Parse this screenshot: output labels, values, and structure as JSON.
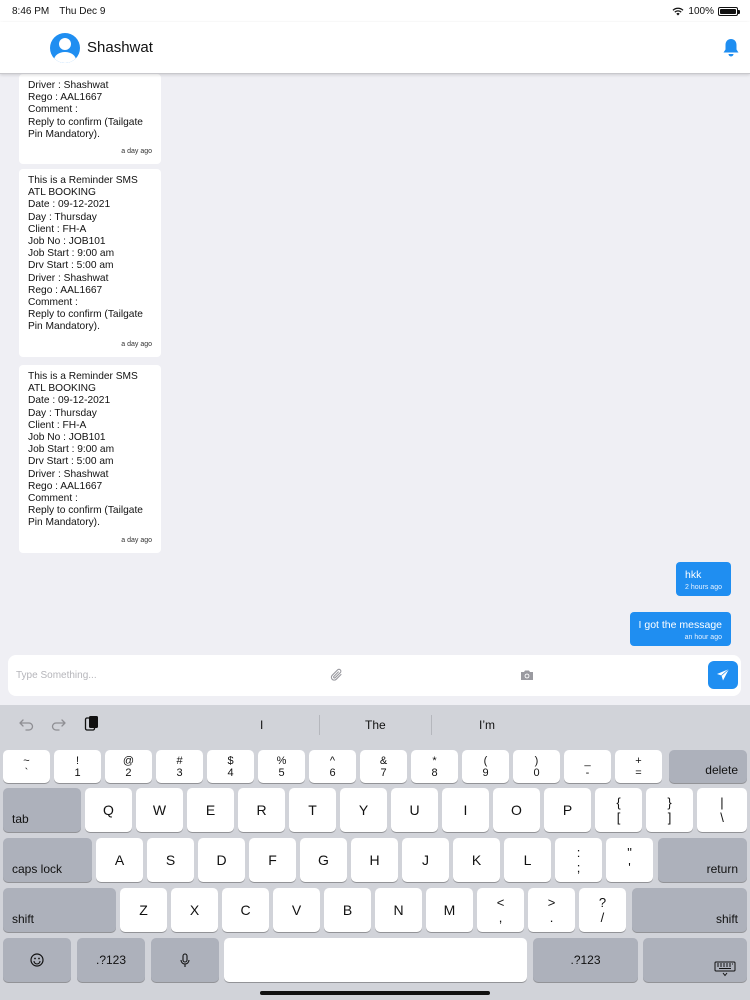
{
  "status": {
    "time": "8:46 PM",
    "date": "Thu Dec 9",
    "battery": "100%"
  },
  "header": {
    "contact_name": "Shashwat"
  },
  "messages_in": [
    {
      "text": "Driver : Shashwat\nRego : AAL1667\nComment :\nReply to confirm (Tailgate Pin Mandatory).",
      "time": "a day ago"
    },
    {
      "text": "This is a Reminder SMS\nATL BOOKING\nDate : 09-12-2021\nDay : Thursday\nClient : FH-A\nJob No : JOB101\nJob Start : 9:00 am\nDrv Start : 5:00 am\nDriver : Shashwat\nRego : AAL1667\nComment :\nReply to confirm (Tailgate Pin Mandatory).",
      "time": "a day ago"
    },
    {
      "text": "This is a Reminder SMS\nATL BOOKING\nDate : 09-12-2021\nDay : Thursday\nClient : FH-A\nJob No : JOB101\nJob Start : 9:00 am\nDrv Start : 5:00 am\nDriver : Shashwat\nRego : AAL1667\nComment :\nReply to confirm (Tailgate Pin Mandatory).",
      "time": "a day ago"
    }
  ],
  "messages_out": [
    {
      "text": "hkk",
      "time": "2 hours ago"
    },
    {
      "text": "I got the message",
      "time": "an hour ago"
    }
  ],
  "composer": {
    "placeholder": "Type Something..."
  },
  "keyboard": {
    "suggestions": [
      "I",
      "The",
      "I’m"
    ],
    "row1": [
      {
        "top": "~",
        "bottom": "`"
      },
      {
        "top": "!",
        "bottom": "1"
      },
      {
        "top": "@",
        "bottom": "2"
      },
      {
        "top": "#",
        "bottom": "3"
      },
      {
        "top": "$",
        "bottom": "4"
      },
      {
        "top": "%",
        "bottom": "5"
      },
      {
        "top": "^",
        "bottom": "6"
      },
      {
        "top": "&",
        "bottom": "7"
      },
      {
        "top": "*",
        "bottom": "8"
      },
      {
        "top": "(",
        "bottom": "9"
      },
      {
        "top": ")",
        "bottom": "0"
      },
      {
        "top": "_",
        "bottom": "-"
      },
      {
        "top": "+",
        "bottom": "="
      }
    ],
    "delete": "delete",
    "tab": "tab",
    "row2": [
      "Q",
      "W",
      "E",
      "R",
      "T",
      "Y",
      "U",
      "I",
      "O",
      "P"
    ],
    "row2_extra": [
      {
        "top": "{",
        "bottom": "["
      },
      {
        "top": "}",
        "bottom": "]"
      },
      {
        "top": "|",
        "bottom": "\\"
      }
    ],
    "caps": "caps lock",
    "row3": [
      "A",
      "S",
      "D",
      "F",
      "G",
      "H",
      "J",
      "K",
      "L"
    ],
    "row3_extra": [
      {
        "top": ":",
        "bottom": ";"
      },
      {
        "top": "\"",
        "bottom": "'"
      }
    ],
    "return": "return",
    "shift": "shift",
    "row4": [
      "Z",
      "X",
      "C",
      "V",
      "B",
      "N",
      "M"
    ],
    "row4_extra": [
      {
        "top": "<",
        "bottom": ","
      },
      {
        "top": ">",
        "bottom": "."
      },
      {
        "top": "?",
        "bottom": "/"
      }
    ],
    "num": ".?123"
  }
}
